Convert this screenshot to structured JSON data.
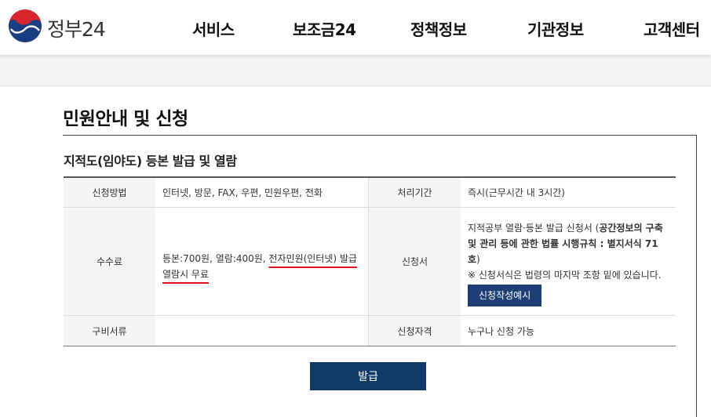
{
  "header": {
    "logo_text": "정부24",
    "nav": [
      "서비스",
      "보조금24",
      "정책정보",
      "기관정보",
      "고객센터"
    ]
  },
  "page": {
    "title": "민원안내 및 신청",
    "subtitle": "지적도(임야도) 등본 발급 및 열람"
  },
  "table": {
    "method_label": "신청방법",
    "method_value": "인터넷, 방문, FAX, 우편, 민원우편, 전화",
    "period_label": "처리기간",
    "period_value": "즉시(근무시간 내 3시간)",
    "fee_label": "수수료",
    "fee_value_part1": "등본:700원, 열람:400원, ",
    "fee_value_part2": "전자민원(인터넷) 발급 열람시 무료",
    "form_label": "신청서",
    "form_text1": "지적공부 열람·등본 발급 신청서 (",
    "form_bold": "공간정보의 구축 및 관리 등에 관한 법률 시행규칙 : 별지서식 71호",
    "form_text2": ")",
    "form_note": "※ 신청서식은 법령의 마지막 조항 밑에 있습니다.",
    "form_button": "신청작성예시",
    "docs_label": "구비서류",
    "docs_value": "",
    "eligibility_label": "신청자격",
    "eligibility_value": "누구나 신청 가능"
  },
  "actions": {
    "issue_button": "발급"
  },
  "colors": {
    "primary": "#123a66",
    "accent_underline": "#e0141e",
    "button_blue": "#1e3f75"
  }
}
